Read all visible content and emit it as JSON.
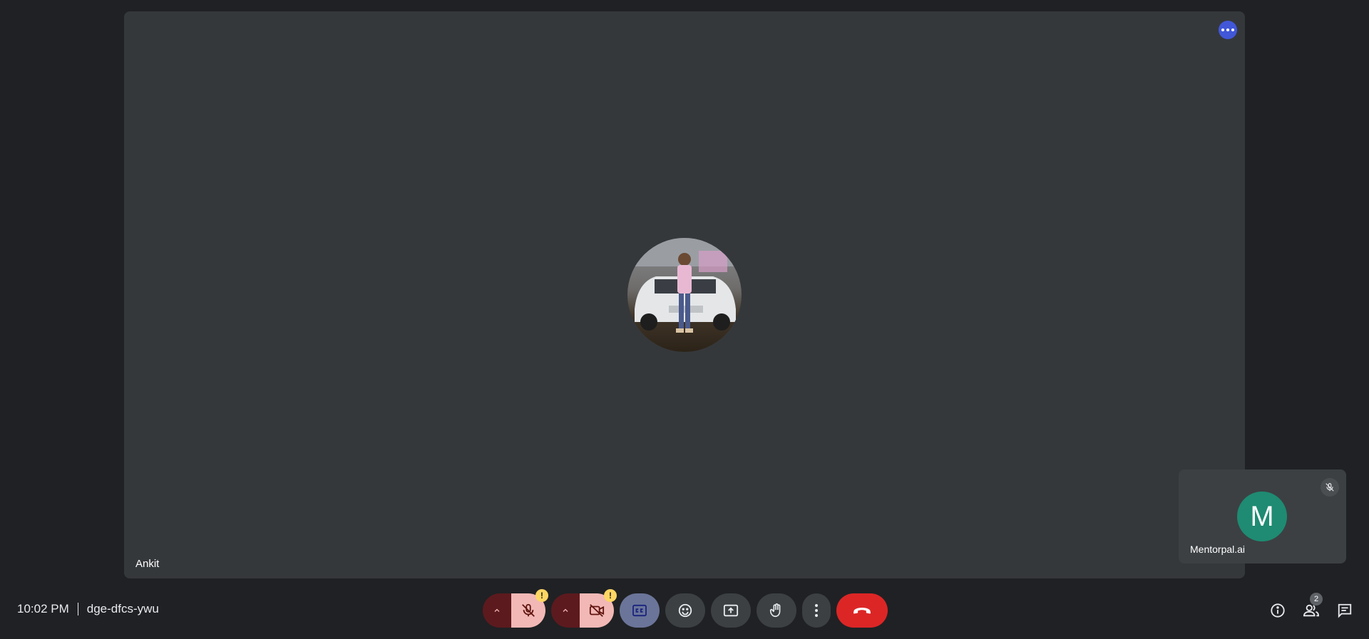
{
  "main_tile": {
    "participant_name": "Ankit",
    "more_options_icon": "more-horiz-icon",
    "avatar_kind": "profile-photo"
  },
  "self_tile": {
    "initial": "M",
    "name": "Mentorpal.ai",
    "avatar_color": "#1e8b72",
    "status_icon": "mic-off-icon"
  },
  "meeting": {
    "time": "10:02 PM",
    "code": "dge-dfcs-ywu"
  },
  "controls": {
    "mic": {
      "icon": "mic-off-icon",
      "warning": "!",
      "options_icon": "chevron-up-icon"
    },
    "camera": {
      "icon": "videocam-off-icon",
      "warning": "!",
      "options_icon": "chevron-up-icon"
    },
    "captions": {
      "icon": "closed-captions-icon"
    },
    "emoji": {
      "icon": "emoji-icon"
    },
    "present": {
      "icon": "present-screen-icon"
    },
    "raise_hand": {
      "icon": "hand-icon"
    },
    "more": {
      "icon": "more-vert-icon"
    },
    "leave": {
      "icon": "call-end-icon",
      "color": "#dc2626"
    }
  },
  "side_controls": {
    "info_icon": "info-icon",
    "people_icon": "people-icon",
    "people_count": "2",
    "chat_icon": "chat-icon"
  }
}
